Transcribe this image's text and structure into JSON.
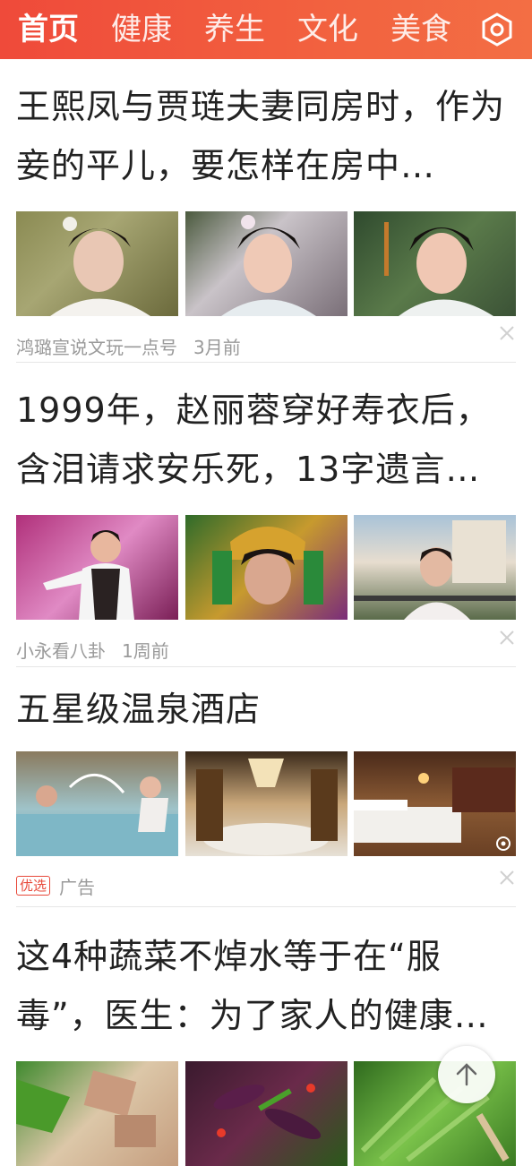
{
  "nav": {
    "tabs": [
      {
        "label": "首页",
        "active": true
      },
      {
        "label": "健康",
        "active": false
      },
      {
        "label": "养生",
        "active": false
      },
      {
        "label": "文化",
        "active": false
      },
      {
        "label": "美食",
        "active": false
      }
    ],
    "settings_icon": "hexagon-settings-icon",
    "accent_color": "#ef4a3a"
  },
  "articles": [
    {
      "title": "王熙凤与贾琏夫妻同房时，作为妾的平儿，要怎样在房中…",
      "source": "鸿璐宣说文玩一点号",
      "time": "3月前"
    },
    {
      "title": "1999年，赵丽蓉穿好寿衣后，含泪请求安乐死，13字遗言…",
      "source": "小永看八卦",
      "time": "1周前"
    },
    {
      "title": "五星级温泉酒店",
      "badge": "优选",
      "source": "广告"
    },
    {
      "title": "这4种蔬菜不焯水等于在“服毒”，医生：为了家人的健康…"
    }
  ],
  "icons": {
    "dismiss": "close-icon",
    "back_to_top": "arrow-up-icon"
  }
}
